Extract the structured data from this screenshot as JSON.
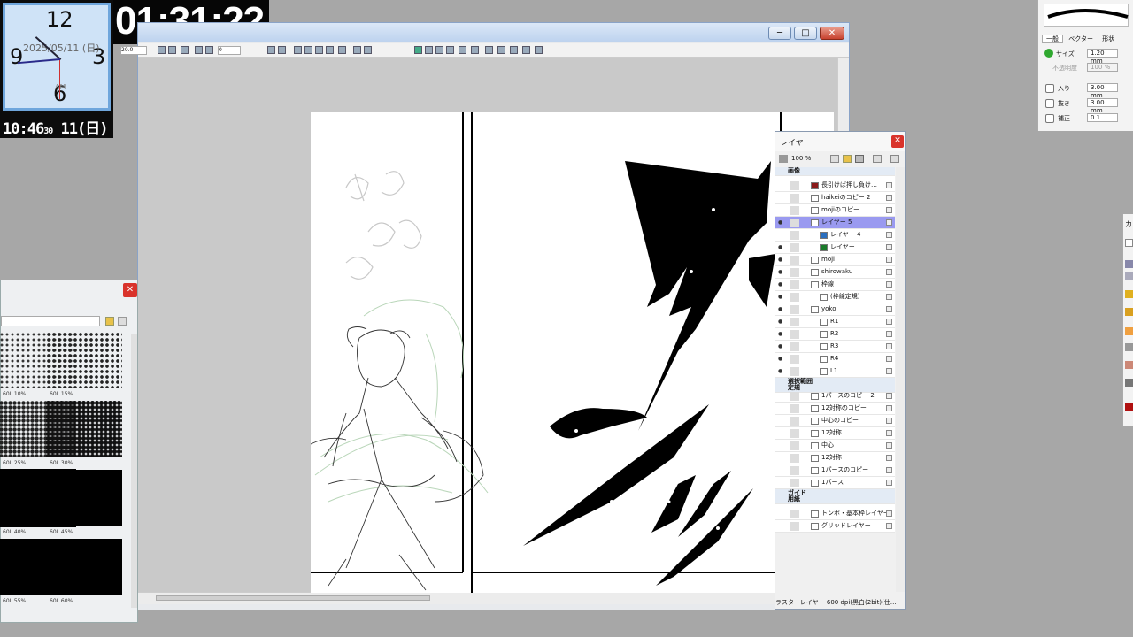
{
  "clock": {
    "n12": "12",
    "n3": "3",
    "n6": "6",
    "n9": "9",
    "date": "2025/05/11 (日)",
    "ampm": "AM",
    "time_hm": "10:46",
    "time_s": "30",
    "day": "11(日)"
  },
  "timer": {
    "text": "01:31:22"
  },
  "main_window": {
    "toolbar": {
      "zoom": "20.0",
      "rotate": "0"
    },
    "window_buttons": {
      "minimize": "─",
      "maximize": "□",
      "close": "✕"
    }
  },
  "tone_panel": {
    "close": "✕",
    "tones": [
      {
        "label": "60L 10%",
        "dot": "#333"
      },
      {
        "label": "60L 15%",
        "dot": "#222"
      },
      {
        "label": "60L 25%",
        "dot": "#222"
      },
      {
        "label": "60L 30%",
        "dot": "#111"
      },
      {
        "label": "60L 40%",
        "dot": "#000"
      },
      {
        "label": "60L 45%",
        "dot": "#000"
      },
      {
        "label": "60L 55%",
        "dot": "#000"
      },
      {
        "label": "60L 60%",
        "dot": "#000"
      }
    ]
  },
  "layer_panel": {
    "title": "レイヤー",
    "close": "✕",
    "opacity": "100 %",
    "status": "ラスターレイヤー 600 dpi(黒白(2bit)(仕…",
    "layers": [
      {
        "name": "画像",
        "type": "group",
        "indent": 0,
        "eye": ""
      },
      {
        "name": "長引けば押し負け…",
        "indent": 1,
        "eye": "",
        "thumb": "#8b1a1a"
      },
      {
        "name": "haikeiのコピー 2",
        "indent": 1,
        "eye": ""
      },
      {
        "name": "mojiのコピー",
        "indent": 1,
        "eye": ""
      },
      {
        "name": "レイヤー 5",
        "indent": 1,
        "eye": "●",
        "selected": true
      },
      {
        "name": "レイヤー 4",
        "indent": 2,
        "eye": "",
        "thumb": "#2a6fbf"
      },
      {
        "name": "レイヤー",
        "indent": 2,
        "eye": "●",
        "thumb": "#1a7a2a"
      },
      {
        "name": "moji",
        "indent": 1,
        "eye": "●"
      },
      {
        "name": "shirowaku",
        "indent": 1,
        "eye": "●"
      },
      {
        "name": "枠線",
        "indent": 1,
        "eye": "●",
        "folder": true
      },
      {
        "name": "(枠線定規)",
        "indent": 2,
        "eye": "●"
      },
      {
        "name": "yoko",
        "indent": 1,
        "eye": "●"
      },
      {
        "name": "R1",
        "indent": 2,
        "eye": "●"
      },
      {
        "name": "R2",
        "indent": 2,
        "eye": "●"
      },
      {
        "name": "R3",
        "indent": 2,
        "eye": "●"
      },
      {
        "name": "R4",
        "indent": 2,
        "eye": "●"
      },
      {
        "name": "L1",
        "indent": 2,
        "eye": "●"
      },
      {
        "name": "選択範囲",
        "type": "group",
        "indent": 0,
        "eye": ""
      },
      {
        "name": "定規",
        "type": "group",
        "indent": 0,
        "eye": ""
      },
      {
        "name": "1パースのコピー 2",
        "indent": 1,
        "eye": ""
      },
      {
        "name": "12対称のコピー",
        "indent": 1,
        "eye": ""
      },
      {
        "name": "中心のコピー",
        "indent": 1,
        "eye": ""
      },
      {
        "name": "12対称",
        "indent": 1,
        "eye": ""
      },
      {
        "name": "中心",
        "indent": 1,
        "eye": ""
      },
      {
        "name": "12対称",
        "indent": 1,
        "eye": ""
      },
      {
        "name": "1パースのコピー",
        "indent": 1,
        "eye": ""
      },
      {
        "name": "1パース",
        "indent": 1,
        "eye": ""
      },
      {
        "name": "ガイド",
        "type": "group",
        "indent": 0,
        "eye": ""
      },
      {
        "name": "用紙",
        "type": "group",
        "indent": 0,
        "eye": ""
      },
      {
        "name": "トンボ・基本枠レイヤー",
        "indent": 1,
        "eye": ""
      },
      {
        "name": "グリッドレイヤー",
        "indent": 1,
        "eye": ""
      }
    ]
  },
  "brush_panel": {
    "tabs": [
      "一般",
      "ベクター",
      "形状"
    ],
    "size_label": "サイズ",
    "size_value": "1.20 mm",
    "opacity_label": "不透明度",
    "opacity_value": "100 %",
    "in_label": "入り",
    "in_value": "3.00 mm",
    "out_label": "抜き",
    "out_value": "3.00 mm",
    "correct_label": "補正",
    "correct_value": "0.1"
  },
  "right_strip": {
    "label": "カ"
  }
}
